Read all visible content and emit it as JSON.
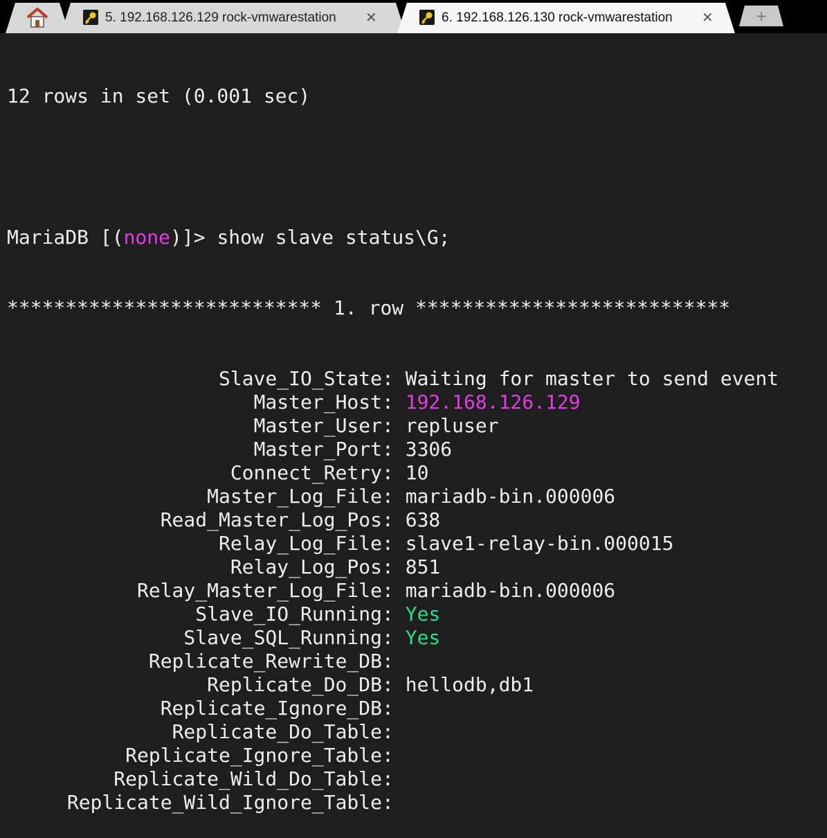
{
  "tabs": {
    "home": {
      "icon": "home-icon"
    },
    "tab1": {
      "icon": "key-icon",
      "label": "5. 192.168.126.129 rock-vmwarestation"
    },
    "tab2": {
      "icon": "key-icon",
      "label": "6. 192.168.126.130 rock-vmwarestation"
    },
    "new_tab": {
      "icon": "plus-icon"
    }
  },
  "terminal": {
    "line_rows": "12 rows in set (0.001 sec)",
    "prompt_pre": "MariaDB [(",
    "prompt_db": "none",
    "prompt_post": ")]> ",
    "command": "show slave status\\G;",
    "row_header": "*************************** 1. row ***************************",
    "fields": [
      {
        "name": "Slave_IO_State",
        "value": "Waiting for master to send event"
      },
      {
        "name": "Master_Host",
        "value": "192.168.126.129"
      },
      {
        "name": "Master_User",
        "value": "repluser"
      },
      {
        "name": "Master_Port",
        "value": "3306"
      },
      {
        "name": "Connect_Retry",
        "value": "10"
      },
      {
        "name": "Master_Log_File",
        "value": "mariadb-bin.000006"
      },
      {
        "name": "Read_Master_Log_Pos",
        "value": "638"
      },
      {
        "name": "Relay_Log_File",
        "value": "slave1-relay-bin.000015"
      },
      {
        "name": "Relay_Log_Pos",
        "value": "851"
      },
      {
        "name": "Relay_Master_Log_File",
        "value": "mariadb-bin.000006"
      },
      {
        "name": "Slave_IO_Running",
        "value": "Yes"
      },
      {
        "name": "Slave_SQL_Running",
        "value": "Yes"
      },
      {
        "name": "Replicate_Rewrite_DB",
        "value": ""
      },
      {
        "name": "Replicate_Do_DB",
        "value": "hellodb,db1"
      },
      {
        "name": "Replicate_Ignore_DB",
        "value": ""
      },
      {
        "name": "Replicate_Do_Table",
        "value": ""
      },
      {
        "name": "Replicate_Ignore_Table",
        "value": ""
      },
      {
        "name": "Replicate_Wild_Do_Table",
        "value": ""
      },
      {
        "name": "Replicate_Wild_Ignore_Table",
        "value": ""
      }
    ],
    "colors": {
      "background": "#1e1e1e",
      "text": "#ededed",
      "highlight": "#e43ce4",
      "success": "#2bde8c"
    }
  }
}
